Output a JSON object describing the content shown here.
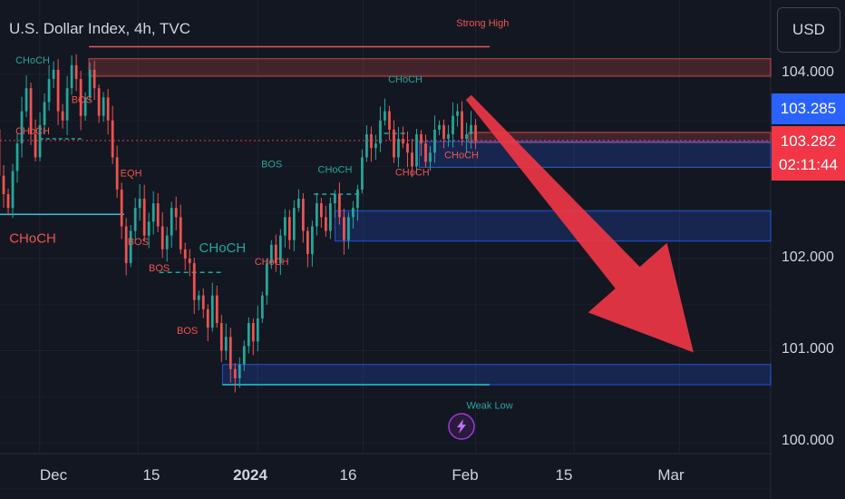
{
  "header": {
    "title": "U.S. Dollar Index, 4h, TVC",
    "currency": "USD"
  },
  "colors": {
    "background": "#131722",
    "up": "#26a69a",
    "down": "#ef5350",
    "zone_red": "#ef5350",
    "zone_blue": "#2962ff",
    "arrow": "#f23645"
  },
  "price_axis": {
    "ticks": [
      {
        "label": "104.000",
        "value": 104.0
      },
      {
        "label": "102.000",
        "value": 102.0
      },
      {
        "label": "101.000",
        "value": 101.0
      },
      {
        "label": "100.000",
        "value": 100.0
      }
    ],
    "current_price": {
      "label": "103.285",
      "value": 103.285,
      "color": "#2962ff"
    },
    "last_price": {
      "label": "103.282",
      "value": 103.282,
      "color": "#f23645"
    },
    "countdown": "02:11:44"
  },
  "time_axis": {
    "ticks": [
      {
        "label": "Dec",
        "date": "2023-12-01"
      },
      {
        "label": "15",
        "date": "2023-12-15"
      },
      {
        "label": "2024",
        "date": "2024-01-01"
      },
      {
        "label": "16",
        "date": "2024-01-16"
      },
      {
        "label": "Feb",
        "date": "2024-02-01"
      },
      {
        "label": "15",
        "date": "2024-02-15"
      },
      {
        "label": "Mar",
        "date": "2024-03-01"
      }
    ]
  },
  "chart_data": {
    "type": "candlestick",
    "title": "U.S. Dollar Index, 4h, TVC",
    "ylim": [
      99.99,
      104.24
    ],
    "xlim": [
      "2023-11-22",
      "2024-03-15"
    ],
    "close_series": {
      "start": "2023-11-22",
      "end": "2024-02-01",
      "values": [
        103.85,
        103.55,
        103.2,
        103.05,
        103.4,
        102.9,
        102.7,
        102.55,
        102.95,
        103.25,
        103.6,
        103.85,
        103.35,
        103.1,
        103.45,
        103.7,
        103.95,
        104.05,
        103.6,
        103.5,
        103.85,
        104.1,
        103.95,
        103.55,
        103.75,
        104.05,
        103.85,
        103.55,
        103.75,
        103.5,
        103.1,
        102.75,
        102.35,
        101.95,
        102.3,
        102.55,
        102.65,
        102.25,
        102.4,
        102.6,
        102.35,
        102.1,
        102.25,
        102.55,
        102.45,
        102.1,
        102.0,
        101.95,
        101.55,
        101.6,
        101.45,
        101.25,
        101.6,
        101.3,
        101.0,
        101.15,
        100.8,
        100.7,
        100.85,
        101.05,
        101.3,
        101.1,
        101.35,
        101.6,
        101.95,
        102.15,
        101.95,
        102.25,
        102.45,
        102.2,
        102.55,
        102.65,
        102.3,
        102.05,
        102.35,
        102.6,
        102.45,
        102.3,
        102.6,
        102.7,
        102.45,
        102.2,
        102.45,
        102.55,
        102.75,
        103.1,
        103.35,
        103.2,
        103.25,
        103.5,
        103.6,
        103.4,
        103.1,
        103.3,
        103.25,
        103.15,
        103.0,
        103.35,
        103.25,
        103.05,
        103.15,
        103.4,
        103.45,
        103.3,
        103.35,
        103.55,
        103.6,
        103.3,
        103.35,
        103.45,
        103.28
      ]
    },
    "zones": [
      {
        "kind": "supply",
        "from": "2023-12-08",
        "to": "2024-03-15",
        "low": 103.98,
        "high": 104.17
      },
      {
        "kind": "supply",
        "from": "2024-01-31",
        "to": "2024-03-15",
        "low": 103.26,
        "high": 103.37
      },
      {
        "kind": "demand",
        "from": "2024-01-24",
        "to": "2024-03-15",
        "low": 102.99,
        "high": 103.27
      },
      {
        "kind": "demand",
        "from": "2024-01-12",
        "to": "2024-03-15",
        "low": 102.19,
        "high": 102.52
      },
      {
        "kind": "demand",
        "from": "2023-12-27",
        "to": "2024-03-15",
        "low": 100.63,
        "high": 100.85
      }
    ],
    "annotations": [
      {
        "text": "Strong High",
        "date": "2024-02-02",
        "price": 104.52,
        "color": "#ef5350"
      },
      {
        "text": "Weak Low",
        "date": "2024-02-03",
        "price": 100.37,
        "color": "#26a69a"
      },
      {
        "text": "CHoCH",
        "date": "2023-11-30",
        "price": 104.12,
        "color": "#26a69a"
      },
      {
        "text": "BOS",
        "date": "2023-12-07",
        "price": 103.69,
        "color": "#ef5350"
      },
      {
        "text": "CHoCH",
        "date": "2023-11-30",
        "price": 103.35,
        "color": "#ef5350"
      },
      {
        "text": "CHoCH",
        "date": "2023-11-30",
        "price": 102.17,
        "color": "#ef5350"
      },
      {
        "text": "EQH",
        "date": "2023-12-14",
        "price": 102.89,
        "color": "#ef5350"
      },
      {
        "text": "BOS",
        "date": "2023-12-15",
        "price": 102.15,
        "color": "#ef5350"
      },
      {
        "text": "BOS",
        "date": "2023-12-18",
        "price": 101.86,
        "color": "#ef5350"
      },
      {
        "text": "CHoCH",
        "date": "2023-12-27",
        "price": 102.07,
        "color": "#26a69a"
      },
      {
        "text": "BOS",
        "date": "2023-12-22",
        "price": 101.18,
        "color": "#ef5350"
      },
      {
        "text": "CHoCH",
        "date": "2024-01-03",
        "price": 101.93,
        "color": "#ef5350"
      },
      {
        "text": "BOS",
        "date": "2024-01-03",
        "price": 102.99,
        "color": "#26a69a"
      },
      {
        "text": "CHoCH",
        "date": "2024-01-12",
        "price": 102.93,
        "color": "#26a69a"
      },
      {
        "text": "CHoCH",
        "date": "2024-01-22",
        "price": 103.91,
        "color": "#26a69a"
      },
      {
        "text": "CHoCH",
        "date": "2024-01-23",
        "price": 102.9,
        "color": "#ef5350"
      },
      {
        "text": "CHoCH",
        "date": "2024-01-30",
        "price": 103.09,
        "color": "#ef5350"
      }
    ],
    "arrow": {
      "from": {
        "date": "2024-01-31",
        "price": 103.75
      },
      "to": {
        "date": "2024-03-03",
        "price": 100.98
      },
      "color": "#f23645"
    }
  }
}
